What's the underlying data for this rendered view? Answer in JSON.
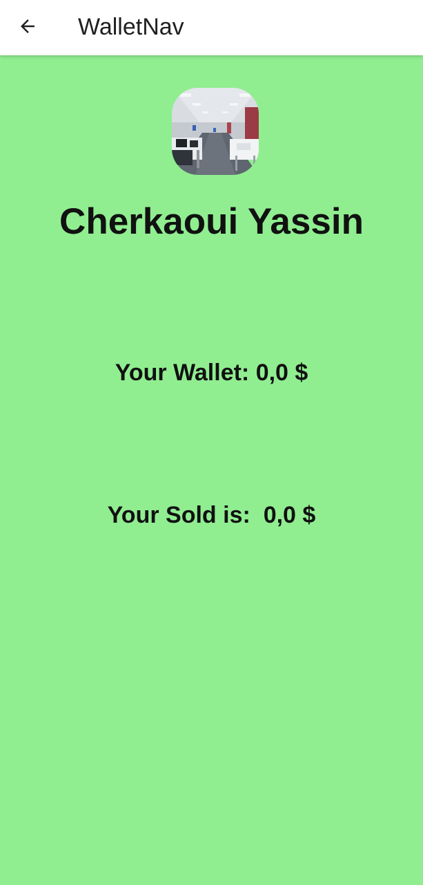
{
  "header": {
    "back_icon": "arrow-left-icon",
    "title": "WalletNav"
  },
  "profile": {
    "avatar_description": "office photo",
    "name": "Cherkaoui Yassin"
  },
  "wallet": {
    "text": "Your Wallet: 0,0 $"
  },
  "sold": {
    "text": "Your Sold is:  0,0 $"
  },
  "colors": {
    "background": "#90EE90",
    "topbar": "#FFFFFF",
    "text": "#111111"
  }
}
